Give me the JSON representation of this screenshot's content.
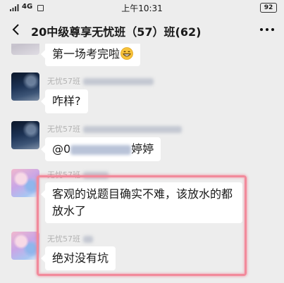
{
  "status_bar": {
    "network": "4G",
    "time": "上午10:31",
    "battery": "92",
    "signal_icon": "signal-bars-icon"
  },
  "nav": {
    "title": "20中级尊享无忧班（57）班(62)",
    "back_icon": "chevron-left-icon",
    "more_icon": "more-dots-icon"
  },
  "messages": [
    {
      "sender": "",
      "text": "第一场考完啦",
      "emoji": "grinning-face-emoji-icon"
    },
    {
      "sender": "无忧57班",
      "text": "咋样?"
    },
    {
      "sender": "无忧57班",
      "text_prefix": "@0",
      "text_suffix": "婷婷"
    },
    {
      "sender": "无忧57班",
      "text": "客观的说题目确实不难，该放水的都放水了"
    },
    {
      "sender": "无忧57班",
      "text": "绝对没有坑"
    }
  ],
  "highlight": {
    "color": "#f28a9b"
  },
  "colors": {
    "background": "#ededed",
    "bubble": "#ffffff",
    "sender_name": "#b2b2b2"
  }
}
